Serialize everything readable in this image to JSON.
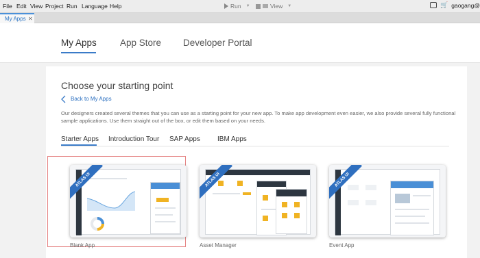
{
  "menubar": {
    "items": [
      "File",
      "Edit",
      "View",
      "Project",
      "Run",
      "Language",
      "Help"
    ],
    "run_label": "Run",
    "view_label": "View",
    "user": "gaogang@"
  },
  "tabs": {
    "active": "My Apps"
  },
  "header_nav": [
    "My Apps",
    "App Store",
    "Developer Portal"
  ],
  "panel": {
    "heading": "Choose your starting point",
    "back_link": "Back to My Apps",
    "description": "Our designers created several themes that you can use as a starting point for your new app. To make app development even easier, we also provide several fully functional sample applications. Use them straight out of the box, or edit them based on your needs.",
    "subtabs": [
      "Starter Apps",
      "Introduction Tour",
      "SAP Apps",
      "IBM Apps"
    ],
    "cards": [
      {
        "label": "Blank App",
        "ribbon": "ATLAS UI"
      },
      {
        "label": "Asset Manager",
        "ribbon": "ATLAS UI"
      },
      {
        "label": "Event App",
        "ribbon": "ATLAS UI"
      }
    ]
  },
  "colors": {
    "accent": "#3a7bc8",
    "ribbon": "#2f6fbf",
    "selection": "#e58383"
  }
}
